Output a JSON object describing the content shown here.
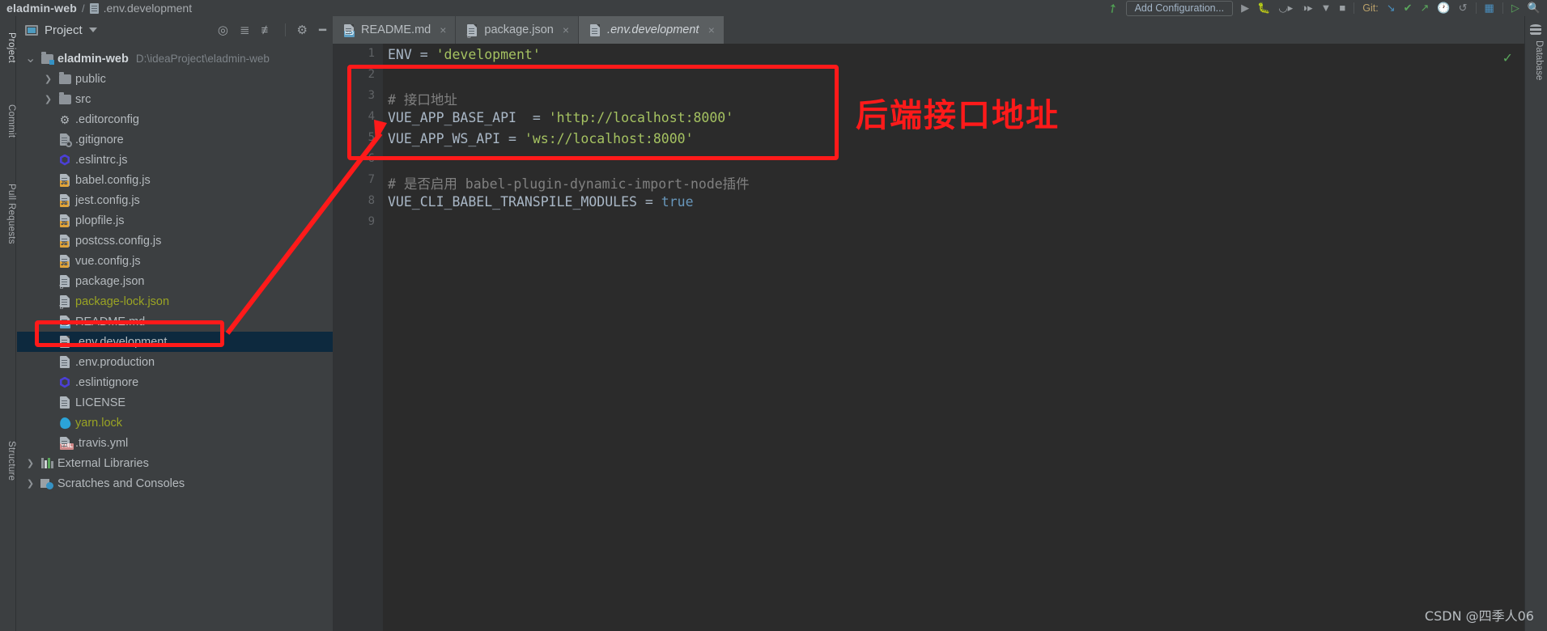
{
  "window": {
    "breadcrumb_project": "eladmin-web",
    "breadcrumb_separator": "/",
    "breadcrumb_file": ".env.development"
  },
  "toolbar": {
    "add_configuration": "Add Configuration...",
    "git_label": "Git:",
    "icons": [
      "hammer-icon",
      "run-icon",
      "debug-icon",
      "run-with-coverage-icon",
      "profile-icon",
      "chevron-down-icon",
      "stop-icon",
      "update-project-icon",
      "commit-icon",
      "push-icon",
      "history-icon",
      "undo-icon",
      "layout-icon",
      "run-anything-icon",
      "search-icon"
    ]
  },
  "left_strip": {
    "tabs": [
      {
        "label": "Project",
        "active": true
      },
      {
        "label": "Commit",
        "active": false
      },
      {
        "label": "Pull Requests",
        "active": false
      },
      {
        "label": "Structure",
        "active": false
      }
    ]
  },
  "right_strip": {
    "tabs": [
      {
        "label": "Database"
      }
    ]
  },
  "project_panel": {
    "title": "Project",
    "actions": [
      "locate-icon",
      "expand-all-icon",
      "collapse-all-icon",
      "settings-gear-icon",
      "hide-icon"
    ],
    "tree": [
      {
        "name": "eladmin-web",
        "path": "D:\\ideaProject\\eladmin-web",
        "icon": "folder-module-icon",
        "arrow": "down",
        "indent": 0,
        "bold": true,
        "color": "default",
        "selected": false
      },
      {
        "name": "public",
        "path": "",
        "icon": "folder-icon",
        "arrow": "right",
        "indent": 1,
        "bold": false,
        "color": "default",
        "selected": false
      },
      {
        "name": "src",
        "path": "",
        "icon": "folder-icon",
        "arrow": "right",
        "indent": 1,
        "bold": false,
        "color": "default",
        "selected": false
      },
      {
        "name": ".editorconfig",
        "path": "",
        "icon": "gear-icon",
        "arrow": "none",
        "indent": 1,
        "bold": false,
        "color": "default",
        "selected": false
      },
      {
        "name": ".gitignore",
        "path": "",
        "icon": "gitignore-icon",
        "arrow": "none",
        "indent": 1,
        "bold": false,
        "color": "default",
        "selected": false
      },
      {
        "name": ".eslintrc.js",
        "path": "",
        "icon": "eslint-icon",
        "arrow": "none",
        "indent": 1,
        "bold": false,
        "color": "default",
        "selected": false
      },
      {
        "name": "babel.config.js",
        "path": "",
        "icon": "js-file-icon",
        "arrow": "none",
        "indent": 1,
        "bold": false,
        "color": "default",
        "selected": false
      },
      {
        "name": "jest.config.js",
        "path": "",
        "icon": "js-file-icon",
        "arrow": "none",
        "indent": 1,
        "bold": false,
        "color": "default",
        "selected": false
      },
      {
        "name": "plopfile.js",
        "path": "",
        "icon": "js-file-icon",
        "arrow": "none",
        "indent": 1,
        "bold": false,
        "color": "default",
        "selected": false
      },
      {
        "name": "postcss.config.js",
        "path": "",
        "icon": "js-file-icon",
        "arrow": "none",
        "indent": 1,
        "bold": false,
        "color": "default",
        "selected": false
      },
      {
        "name": "vue.config.js",
        "path": "",
        "icon": "js-file-icon",
        "arrow": "none",
        "indent": 1,
        "bold": false,
        "color": "default",
        "selected": false
      },
      {
        "name": "package.json",
        "path": "",
        "icon": "json-file-icon",
        "arrow": "none",
        "indent": 1,
        "bold": false,
        "color": "default",
        "selected": false
      },
      {
        "name": "package-lock.json",
        "path": "",
        "icon": "json-file-icon",
        "arrow": "none",
        "indent": 1,
        "bold": false,
        "color": "olive",
        "selected": false
      },
      {
        "name": "README.md",
        "path": "",
        "icon": "md-file-icon",
        "arrow": "none",
        "indent": 1,
        "bold": false,
        "color": "default",
        "selected": false
      },
      {
        "name": ".env.development",
        "path": "",
        "icon": "text-file-icon",
        "arrow": "none",
        "indent": 1,
        "bold": false,
        "color": "default",
        "selected": true
      },
      {
        "name": ".env.production",
        "path": "",
        "icon": "text-file-icon",
        "arrow": "none",
        "indent": 1,
        "bold": false,
        "color": "default",
        "selected": false
      },
      {
        "name": ".eslintignore",
        "path": "",
        "icon": "eslint-icon",
        "arrow": "none",
        "indent": 1,
        "bold": false,
        "color": "default",
        "selected": false
      },
      {
        "name": "LICENSE",
        "path": "",
        "icon": "text-file-icon",
        "arrow": "none",
        "indent": 1,
        "bold": false,
        "color": "default",
        "selected": false
      },
      {
        "name": "yarn.lock",
        "path": "",
        "icon": "yarn-icon",
        "arrow": "none",
        "indent": 1,
        "bold": false,
        "color": "olive",
        "selected": false
      },
      {
        "name": ".travis.yml",
        "path": "",
        "icon": "yml-file-icon",
        "arrow": "none",
        "indent": 1,
        "bold": false,
        "color": "default",
        "selected": false
      },
      {
        "name": "External Libraries",
        "path": "",
        "icon": "libraries-icon",
        "arrow": "right",
        "indent": 0,
        "bold": false,
        "color": "default",
        "selected": false
      },
      {
        "name": "Scratches and Consoles",
        "path": "",
        "icon": "scratches-icon",
        "arrow": "right",
        "indent": 0,
        "bold": false,
        "color": "default",
        "selected": false
      }
    ]
  },
  "editor": {
    "tabs": [
      {
        "label": "README.md",
        "icon": "md-file-icon",
        "active": false,
        "closable": true
      },
      {
        "label": "package.json",
        "icon": "json-file-icon",
        "active": false,
        "closable": true
      },
      {
        "label": ".env.development",
        "icon": "text-file-icon",
        "active": true,
        "closable": true
      }
    ],
    "inspection_status": "ok-check-icon",
    "lines": [
      {
        "n": "1",
        "text": "ENV = 'development'"
      },
      {
        "n": "2",
        "text": ""
      },
      {
        "n": "3",
        "text": "# 接口地址"
      },
      {
        "n": "4",
        "text": "VUE_APP_BASE_API  = 'http://localhost:8000'"
      },
      {
        "n": "5",
        "text": "VUE_APP_WS_API = 'ws://localhost:8000'"
      },
      {
        "n": "6",
        "text": ""
      },
      {
        "n": "7",
        "text": "# 是否启用 babel-plugin-dynamic-import-node插件"
      },
      {
        "n": "8",
        "text": "VUE_CLI_BABEL_TRANSPILE_MODULES = true"
      },
      {
        "n": "9",
        "text": ""
      }
    ]
  },
  "annotations": {
    "label": "后端接口地址",
    "color": "#ff1a1a"
  },
  "watermark": "CSDN @四季人06"
}
